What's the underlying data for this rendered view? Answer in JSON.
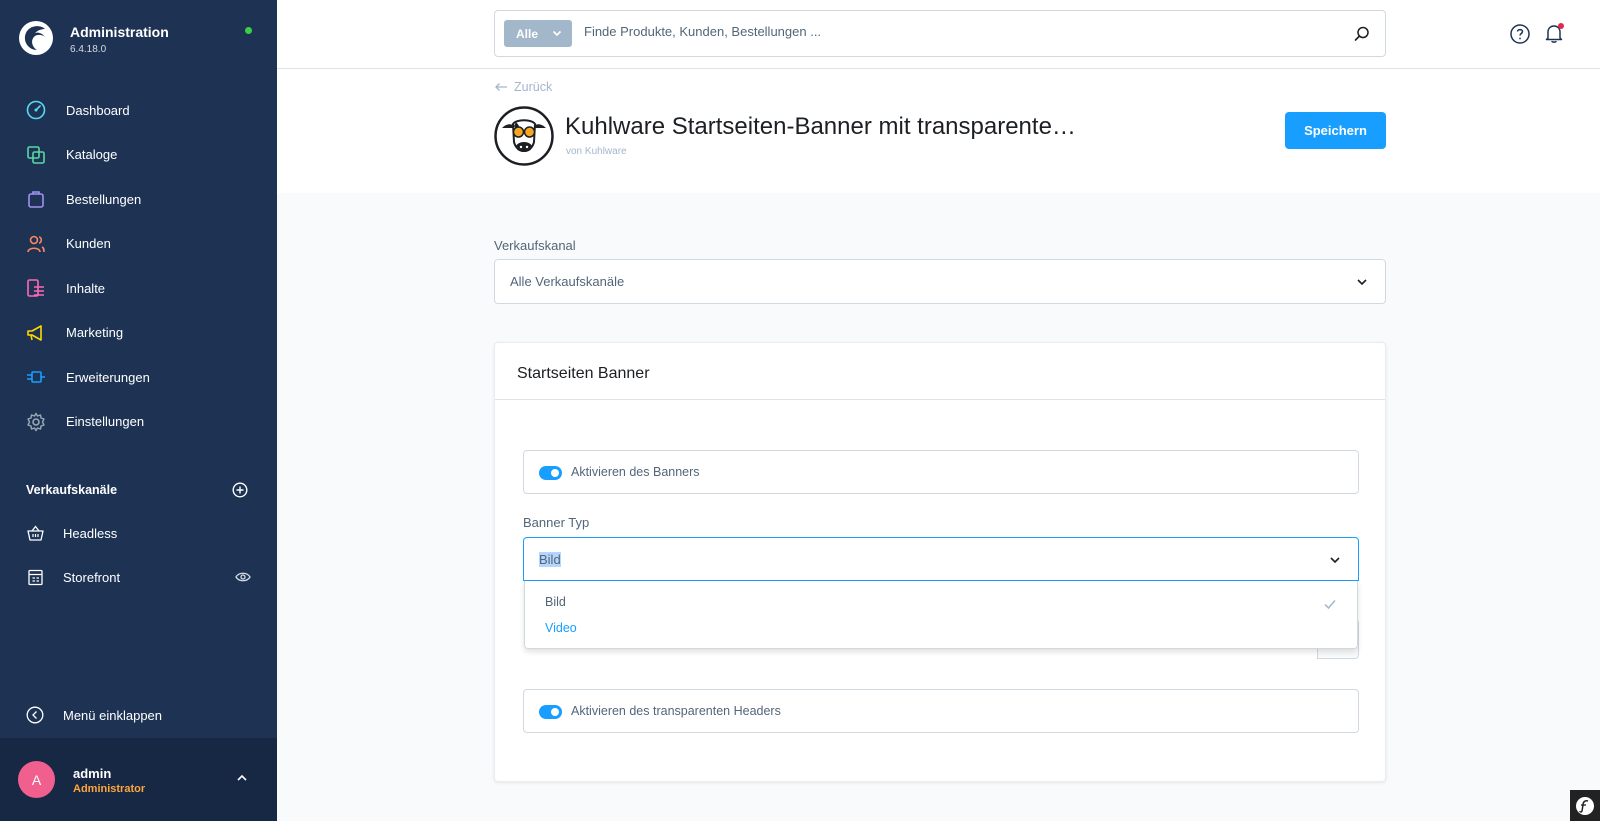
{
  "app": {
    "title": "Administration",
    "version": "6.4.18.0",
    "status_color": "#37d046"
  },
  "sidebar": {
    "items": [
      {
        "label": "Dashboard",
        "icon": "dashboard-icon",
        "color": "#57d9f4"
      },
      {
        "label": "Kataloge",
        "icon": "catalog-icon",
        "color": "#57d9a3"
      },
      {
        "label": "Bestellungen",
        "icon": "orders-icon",
        "color": "#a092f0"
      },
      {
        "label": "Kunden",
        "icon": "customers-icon",
        "color": "#f88962"
      },
      {
        "label": "Inhalte",
        "icon": "content-icon",
        "color": "#ff68b4"
      },
      {
        "label": "Marketing",
        "icon": "marketing-icon",
        "color": "#ffd700"
      },
      {
        "label": "Erweiterungen",
        "icon": "extensions-icon",
        "color": "#189eff"
      },
      {
        "label": "Einstellungen",
        "icon": "settings-icon",
        "color": "#9aa8b5"
      }
    ],
    "sales_channels": {
      "title": "Verkaufskanäle",
      "items": [
        {
          "label": "Headless",
          "icon": "basket-icon"
        },
        {
          "label": "Storefront",
          "icon": "storefront-icon"
        }
      ]
    },
    "collapse_label": "Menü einklappen",
    "user": {
      "initial": "A",
      "name": "admin",
      "role": "Administrator"
    }
  },
  "search": {
    "type_label": "Alle",
    "placeholder": "Finde Produkte, Kunden, Bestellungen ..."
  },
  "header": {
    "back_label": "Zurück",
    "title": "Kuhlware Startseiten-Banner mit transparente…",
    "author": "von Kuhlware",
    "save_label": "Speichern"
  },
  "form": {
    "sales_channel_label": "Verkaufskanal",
    "sales_channel_value": "Alle Verkaufskanäle",
    "card_title": "Startseiten Banner",
    "banner_toggle_label": "Aktivieren des Banners",
    "banner_toggle_on": true,
    "banner_type_label": "Banner Typ",
    "banner_type_value": "Bild",
    "banner_type_options": [
      "Bild",
      "Video"
    ],
    "header_toggle_label": "Aktivieren des transparenten Headers",
    "header_toggle_on": true
  },
  "colors": {
    "accent": "#189eff",
    "sidebar_bg": "#1e3354",
    "role": "#ffa53c"
  }
}
